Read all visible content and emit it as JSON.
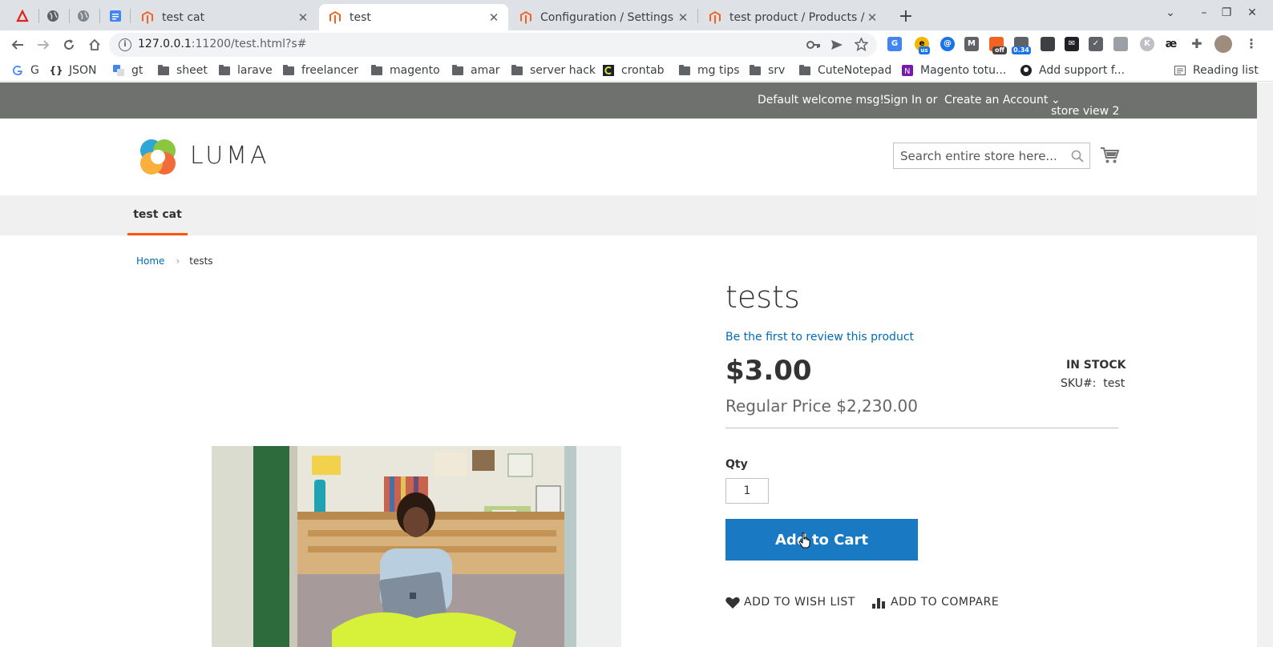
{
  "tabs": [
    {
      "title": "test cat",
      "active": false
    },
    {
      "title": "test",
      "active": true
    },
    {
      "title": "Configuration / Settings /",
      "active": false
    },
    {
      "title": "test product / Products /",
      "active": false
    }
  ],
  "address_bar": {
    "host": "127.0.0.1",
    "path": ":11200/test.html?s#"
  },
  "bookmarks": [
    {
      "label": "G",
      "icon": "google-icon"
    },
    {
      "label": "JSON",
      "icon": "json-icon"
    },
    {
      "label": "gt",
      "icon": "translate-icon"
    },
    {
      "label": "sheet",
      "icon": "folder-icon"
    },
    {
      "label": "larave",
      "icon": "folder-icon"
    },
    {
      "label": "freelancer",
      "icon": "folder-icon"
    },
    {
      "label": "magento",
      "icon": "folder-icon"
    },
    {
      "label": "amar",
      "icon": "folder-icon"
    },
    {
      "label": "server hack",
      "icon": "folder-icon"
    },
    {
      "label": "crontab",
      "icon": "crontab-icon"
    },
    {
      "label": "mg tips",
      "icon": "folder-icon"
    },
    {
      "label": "srv",
      "icon": "folder-icon"
    },
    {
      "label": "CuteNotepad",
      "icon": "folder-icon"
    },
    {
      "label": "Magento totu...",
      "icon": "onenote-icon"
    },
    {
      "label": "Add support f...",
      "icon": "github-icon"
    }
  ],
  "reading_list": "Reading list",
  "extensions": {
    "off_badge": "off",
    "price_badge": "0.34",
    "us_badge": "us"
  },
  "header": {
    "welcome": "Default welcome msg!",
    "sign_in": "Sign In",
    "or": "or",
    "create_account": "Create an Account",
    "store_view": "store view 2"
  },
  "logo_text": "LUMA",
  "search": {
    "placeholder": "Search entire store here..."
  },
  "nav": {
    "items": [
      "test cat"
    ]
  },
  "breadcrumb": {
    "home": "Home",
    "current": "tests"
  },
  "product": {
    "title": "tests",
    "review_link": "Be the first to review this product",
    "price": "$3.00",
    "regular_price": "Regular Price $2,230.00",
    "stock": "IN STOCK",
    "sku_label": "SKU#:",
    "sku_value": "test",
    "qty_label": "Qty",
    "qty_value": "1",
    "add_to_cart": "Add to Cart",
    "wishlist": "ADD TO WISH LIST",
    "compare": "ADD TO COMPARE"
  },
  "colors": {
    "accent": "#1979c3",
    "link": "#006bb4",
    "nav_active": "#ff5501",
    "header_bar": "#6e716e"
  }
}
